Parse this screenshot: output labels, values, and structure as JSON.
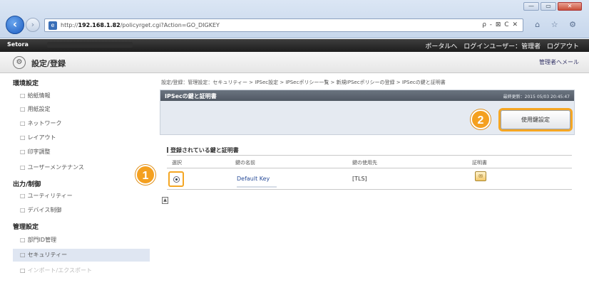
{
  "browser": {
    "back_icon": "back-arrow-icon",
    "url_prefix": "http://",
    "url_host": "192.168.1.82",
    "url_path": "/policyrget.cgi?Action=GO_DIGKEY",
    "tools": "ρ - ⊠ C ✕",
    "window_controls": [
      "—",
      "▭",
      "✕"
    ],
    "right_tools": "⌂ ☆ ⚙"
  },
  "header": {
    "brand": "Setora",
    "links": [
      "ポータルへ",
      "ログインユーザー：管理者",
      "ログアウト"
    ]
  },
  "title_bar": {
    "title": "設定/登録",
    "portal_link": "管理者へメール"
  },
  "sidebar": {
    "sections": [
      {
        "heading": "環境設定",
        "items": [
          "給紙情報",
          "用紙設定",
          "ネットワーク",
          "レイアウト",
          "印字調整",
          "ユーザーメンテナンス"
        ]
      },
      {
        "heading": "出力/制御",
        "items": [
          "ユーティリティー",
          "デバイス制御"
        ]
      },
      {
        "heading": "管理設定",
        "items": [
          "部門ID管理",
          "セキュリティー",
          "インポート/エクスポート"
        ]
      }
    ],
    "bullet": "□",
    "active_item": "セキュリティー"
  },
  "main": {
    "breadcrumb": "設定/登録：管理設定：セキュリティー > IPSec設定 > IPSecポリシー一覧 > 新規IPSecポリシーの登録 > IPSecの鍵と証明書",
    "panel": {
      "title": "IPSecの鍵と証明書",
      "updated": "最終更新：2015 05/03 20:45:47",
      "settings_button": "使用鍵設定"
    },
    "section_title": "登録されている鍵と証明書",
    "columns": [
      "選択",
      "鍵の名前",
      "鍵の使用先",
      "証明書"
    ],
    "rows": [
      {
        "key_name": "Default Key",
        "key_usage": "[TLS]"
      }
    ]
  },
  "callouts": [
    "1",
    "2"
  ]
}
